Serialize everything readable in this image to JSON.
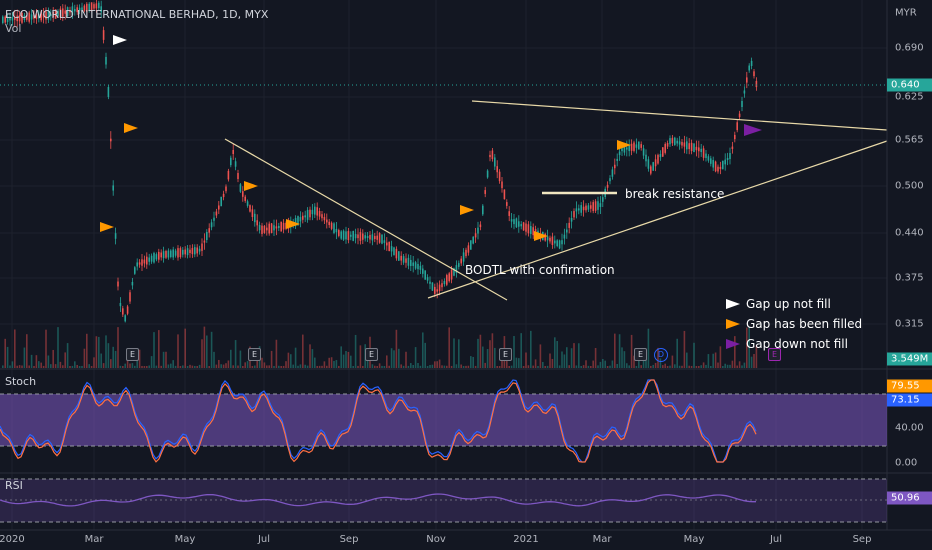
{
  "header": {
    "symbol": "ECO WORLD INTERNATIONAL BERHAD, 1D, MYX",
    "volume_label": "Vol"
  },
  "price_axis": {
    "currency_top": "MYR",
    "ticks": [
      "0.690",
      "0.625",
      "0.565",
      "0.500",
      "0.440",
      "0.375",
      "0.315"
    ],
    "last_price": "0.640",
    "volume_value": "3.549M"
  },
  "stoch": {
    "label": "Stoch",
    "ticks": [
      "40.00",
      "0.00"
    ],
    "k_value": "79.55",
    "d_value": "73.15"
  },
  "rsi": {
    "label": "RSI",
    "value": "50.96"
  },
  "time_axis": [
    "2020",
    "Mar",
    "May",
    "Jul",
    "Sep",
    "Nov",
    "2021",
    "Mar",
    "May",
    "Jul",
    "Sep"
  ],
  "annotations": {
    "break_resistance": "break resistance",
    "bodtl": "BODTL with confirmation"
  },
  "legend": {
    "gap_up": "Gap up not fill",
    "gap_filled": "Gap has been filled",
    "gap_down": "Gap down not fill"
  },
  "event_markers": [
    "E",
    "E",
    "E",
    "E",
    "E",
    "D",
    "E"
  ],
  "colors": {
    "background": "#131722",
    "up": "#26a69a",
    "down": "#ef5350",
    "trendline": "#e8d9a8",
    "stoch_band": "#7e57c2",
    "rsi_line": "#7e57c2",
    "last_price_badge": "#26a69a",
    "stoch_k_badge": "#ff9800",
    "stoch_d_badge": "#2962ff",
    "gap_up_arrow": "#ffffff",
    "gap_filled_arrow": "#ff9800",
    "gap_down_arrow": "#7b1fa2"
  }
}
